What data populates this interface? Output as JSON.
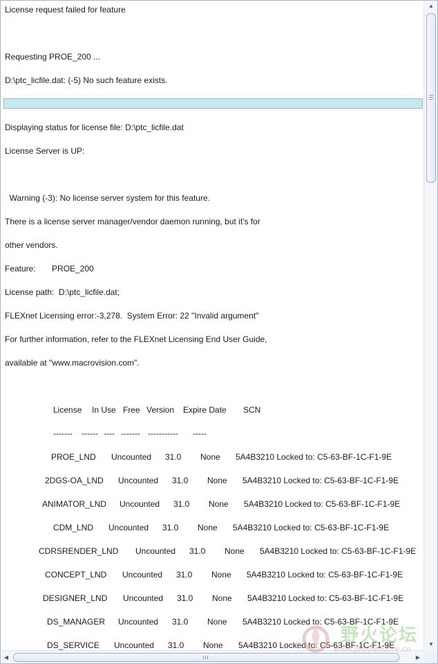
{
  "log_lines": [
    "License request failed for feature",
    "Requesting PROE_200 ...",
    "D:\\ptc_licfile.dat: (-5) No such feature exists.",
    "Displaying status for license file: D:\\ptc_licfile.dat",
    "License Server is UP:",
    "  Warning (-3): No license server system for this feature.",
    "There is a license server manager/vendor daemon running, but it's for",
    "other vendors.",
    "Feature:       PROE_200",
    "License path:  D:\\ptc_licfile.dat;",
    "FLEXnet Licensing error:-3,278.  System Error: 22 \"Invalid argument\"",
    "For further information, refer to the FLEXnet Licensing End User Guide,",
    "available at \"www.macrovision.com\"."
  ],
  "table": {
    "headers": [
      "License",
      "In Use",
      "Free",
      "Version",
      "Expire Date",
      "SCN"
    ],
    "separators": [
      "-------",
      "------",
      "----",
      "-------",
      "-----------",
      "-----"
    ],
    "rows": [
      {
        "license": "PROE_LND",
        "in_use": "Uncounted",
        "version": "31.0",
        "expire": "None",
        "scn": "5A4B3210 Locked to: C5-63-BF-1C-F1-9E"
      },
      {
        "license": "2DGS-OA_LND",
        "in_use": "Uncounted",
        "version": "31.0",
        "expire": "None",
        "scn": "5A4B3210 Locked to: C5-63-BF-1C-F1-9E"
      },
      {
        "license": "ANIMATOR_LND",
        "in_use": "Uncounted",
        "version": "31.0",
        "expire": "None",
        "scn": "5A4B3210 Locked to: C5-63-BF-1C-F1-9E"
      },
      {
        "license": "CDM_LND",
        "in_use": "Uncounted",
        "version": "31.0",
        "expire": "None",
        "scn": "5A4B3210 Locked to: C5-63-BF-1C-F1-9E"
      },
      {
        "license": "CDRSRENDER_LND",
        "in_use": "Uncounted",
        "version": "31.0",
        "expire": "None",
        "scn": "5A4B3210 Locked to: C5-63-BF-1C-F1-9E"
      },
      {
        "license": "CONCEPT_LND",
        "in_use": "Uncounted",
        "version": "31.0",
        "expire": "None",
        "scn": "5A4B3210 Locked to: C5-63-BF-1C-F1-9E"
      },
      {
        "license": "DESIGNER_LND",
        "in_use": "Uncounted",
        "version": "31.0",
        "expire": "None",
        "scn": "5A4B3210 Locked to: C5-63-BF-1C-F1-9E"
      },
      {
        "license": "DS_MANAGER",
        "in_use": "Uncounted",
        "version": "31.0",
        "expire": "None",
        "scn": "5A4B3210 Locked to: C5-63-BF-1C-F1-9E"
      },
      {
        "license": "DS_SERVICE",
        "in_use": "Uncounted",
        "version": "31.0",
        "expire": "None",
        "scn": "5A4B3210 Locked to: C5-63-BF-1C-F1-9E"
      }
    ]
  },
  "watermark": {
    "text": "野火论坛",
    "url": "www.proewildfire.cn"
  },
  "colors": {
    "selection": "#c9e7ee",
    "border": "#a9b7c9"
  }
}
